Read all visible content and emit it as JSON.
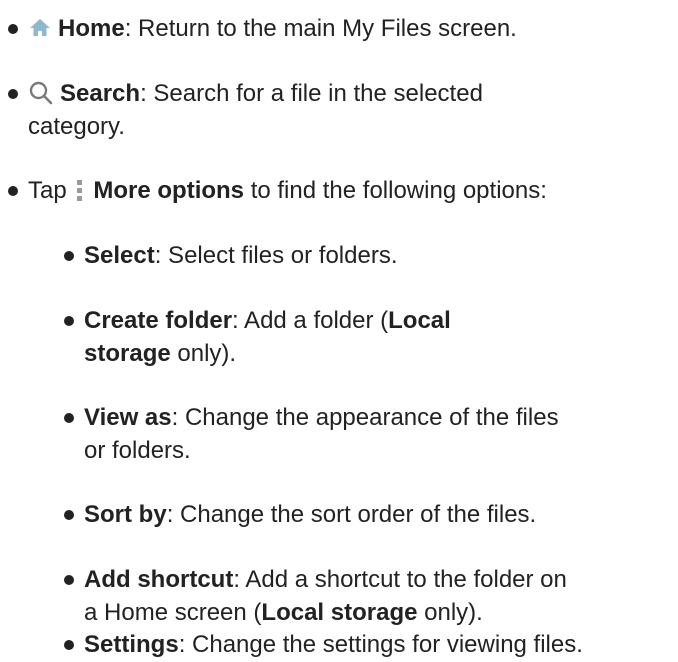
{
  "items": [
    {
      "label": "Home",
      "desc": ": Return to the main My Files screen.",
      "icon": "home-icon",
      "icon_color": "#8fb8cf"
    },
    {
      "label": "Search",
      "desc_line1": ": Search for a file in the selected",
      "desc_line2": "category.",
      "icon": "search-icon",
      "icon_color": "#7a7a7a"
    },
    {
      "prefix": "Tap ",
      "label": "More options",
      "desc": " to find the following options:",
      "icon": "more-options-icon",
      "icon_color": "#9a9a9a"
    }
  ],
  "subitems": [
    {
      "label": "Select",
      "desc": ": Select files or folders."
    },
    {
      "label": "Create folder",
      "desc_line1a": ": Add a folder (",
      "desc_line1b": "Local",
      "desc_line2a": "storage",
      "desc_line2b": " only)."
    },
    {
      "label": "View as",
      "desc_line1": ": Change the appearance of the files",
      "desc_line2": "or folders."
    },
    {
      "label": "Sort by",
      "desc": ": Change the sort order of the files."
    },
    {
      "label": "Add shortcut",
      "desc_line1": ": Add a shortcut to the folder on",
      "desc_line2a": "a Home screen (",
      "desc_line2b": "Local storage",
      "desc_line2c": " only)."
    },
    {
      "label": "Settings",
      "desc": ": Change the settings for viewing files."
    }
  ]
}
